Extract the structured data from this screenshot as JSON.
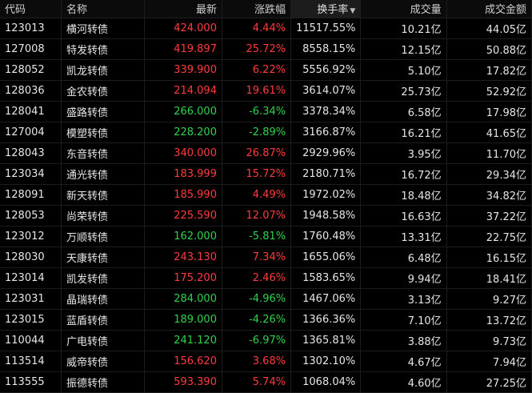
{
  "headers": {
    "code": "代码",
    "name": "名称",
    "price": "最新",
    "change": "涨跌幅",
    "turnover": "换手率",
    "volume": "成交量",
    "amount": "成交金额",
    "sort_indicator": "▼"
  },
  "rows": [
    {
      "code": "123013",
      "name": "横河转债",
      "price": "424.000",
      "change": "4.44%",
      "turnover": "11517.55%",
      "volume": "10.21亿",
      "amount": "44.05亿",
      "dir": "up"
    },
    {
      "code": "127008",
      "name": "特发转债",
      "price": "419.897",
      "change": "25.72%",
      "turnover": "8558.15%",
      "volume": "12.15亿",
      "amount": "50.88亿",
      "dir": "up"
    },
    {
      "code": "128052",
      "name": "凯龙转债",
      "price": "339.900",
      "change": "6.22%",
      "turnover": "5556.92%",
      "volume": "5.10亿",
      "amount": "17.82亿",
      "dir": "up"
    },
    {
      "code": "128036",
      "name": "金农转债",
      "price": "214.094",
      "change": "19.61%",
      "turnover": "3614.07%",
      "volume": "25.73亿",
      "amount": "52.92亿",
      "dir": "up"
    },
    {
      "code": "128041",
      "name": "盛路转债",
      "price": "266.000",
      "change": "-6.34%",
      "turnover": "3378.34%",
      "volume": "6.58亿",
      "amount": "17.98亿",
      "dir": "down"
    },
    {
      "code": "127004",
      "name": "模塑转债",
      "price": "228.200",
      "change": "-2.89%",
      "turnover": "3166.87%",
      "volume": "16.21亿",
      "amount": "41.65亿",
      "dir": "down"
    },
    {
      "code": "128043",
      "name": "东音转债",
      "price": "340.000",
      "change": "26.87%",
      "turnover": "2929.96%",
      "volume": "3.95亿",
      "amount": "11.70亿",
      "dir": "up"
    },
    {
      "code": "123034",
      "name": "通光转债",
      "price": "183.999",
      "change": "15.72%",
      "turnover": "2180.71%",
      "volume": "16.72亿",
      "amount": "29.34亿",
      "dir": "up"
    },
    {
      "code": "128091",
      "name": "新天转债",
      "price": "185.990",
      "change": "4.49%",
      "turnover": "1972.02%",
      "volume": "18.48亿",
      "amount": "34.82亿",
      "dir": "up"
    },
    {
      "code": "128053",
      "name": "尚荣转债",
      "price": "225.590",
      "change": "12.07%",
      "turnover": "1948.58%",
      "volume": "16.63亿",
      "amount": "37.22亿",
      "dir": "up"
    },
    {
      "code": "123012",
      "name": "万顺转债",
      "price": "162.000",
      "change": "-5.81%",
      "turnover": "1760.48%",
      "volume": "13.31亿",
      "amount": "22.75亿",
      "dir": "down"
    },
    {
      "code": "128030",
      "name": "天康转债",
      "price": "243.130",
      "change": "7.34%",
      "turnover": "1655.06%",
      "volume": "6.48亿",
      "amount": "16.15亿",
      "dir": "up"
    },
    {
      "code": "123014",
      "name": "凯发转债",
      "price": "175.200",
      "change": "2.46%",
      "turnover": "1583.65%",
      "volume": "9.94亿",
      "amount": "18.41亿",
      "dir": "up"
    },
    {
      "code": "123031",
      "name": "晶瑞转债",
      "price": "284.000",
      "change": "-4.96%",
      "turnover": "1467.06%",
      "volume": "3.13亿",
      "amount": "9.27亿",
      "dir": "down"
    },
    {
      "code": "123015",
      "name": "蓝盾转债",
      "price": "189.000",
      "change": "-4.26%",
      "turnover": "1366.36%",
      "volume": "7.10亿",
      "amount": "13.72亿",
      "dir": "down"
    },
    {
      "code": "110044",
      "name": "广电转债",
      "price": "241.120",
      "change": "-6.97%",
      "turnover": "1365.81%",
      "volume": "3.88亿",
      "amount": "9.73亿",
      "dir": "down"
    },
    {
      "code": "113514",
      "name": "威帝转债",
      "price": "156.620",
      "change": "3.68%",
      "turnover": "1302.10%",
      "volume": "4.67亿",
      "amount": "7.94亿",
      "dir": "up"
    },
    {
      "code": "113555",
      "name": "振德转债",
      "price": "593.390",
      "change": "5.74%",
      "turnover": "1068.04%",
      "volume": "4.60亿",
      "amount": "27.25亿",
      "dir": "up"
    }
  ],
  "colors": {
    "up": "#ff3b3b",
    "down": "#2fd24c",
    "background": "#000000",
    "header": "#0b0b0b"
  }
}
